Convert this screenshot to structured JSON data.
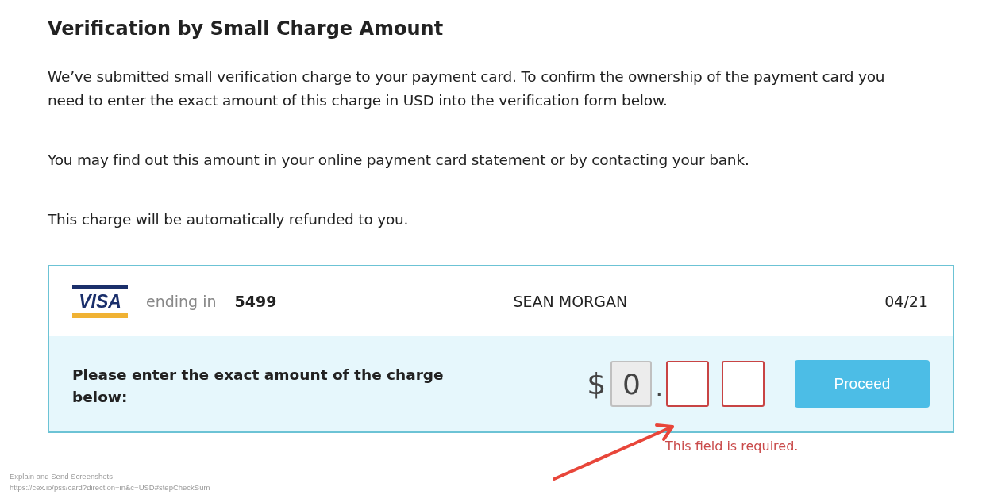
{
  "heading": "Verification by Small Charge Amount",
  "paragraphs": [
    "We’ve submitted small verification charge to your payment card. To confirm the ownership of the payment card you need to enter the exact amount of this charge in USD into the verification form below.",
    "You may find out this amount in your online payment card statement or by contacting your bank.",
    "This charge will be automatically refunded to you."
  ],
  "card": {
    "brand": "VISA",
    "ending_label": "ending in",
    "last_digits": "5499",
    "holder": "SEAN MORGAN",
    "expiry": "04/21"
  },
  "amount_form": {
    "prompt": "Please enter the exact amount of the charge below:",
    "currency": "$",
    "separator": ".",
    "fields": [
      {
        "value": "0",
        "disabled": true,
        "invalid": false
      },
      {
        "disabled": false,
        "invalid": true
      },
      {
        "disabled": false,
        "invalid": true
      }
    ],
    "button": "Proceed",
    "error": "This field is required."
  },
  "annotation": {
    "kind": "arrow"
  },
  "capture_note": [
    "Explain and Send Screenshots",
    "https://cex.io/pss/card?direction=in&c=USD#stepCheckSum"
  ]
}
